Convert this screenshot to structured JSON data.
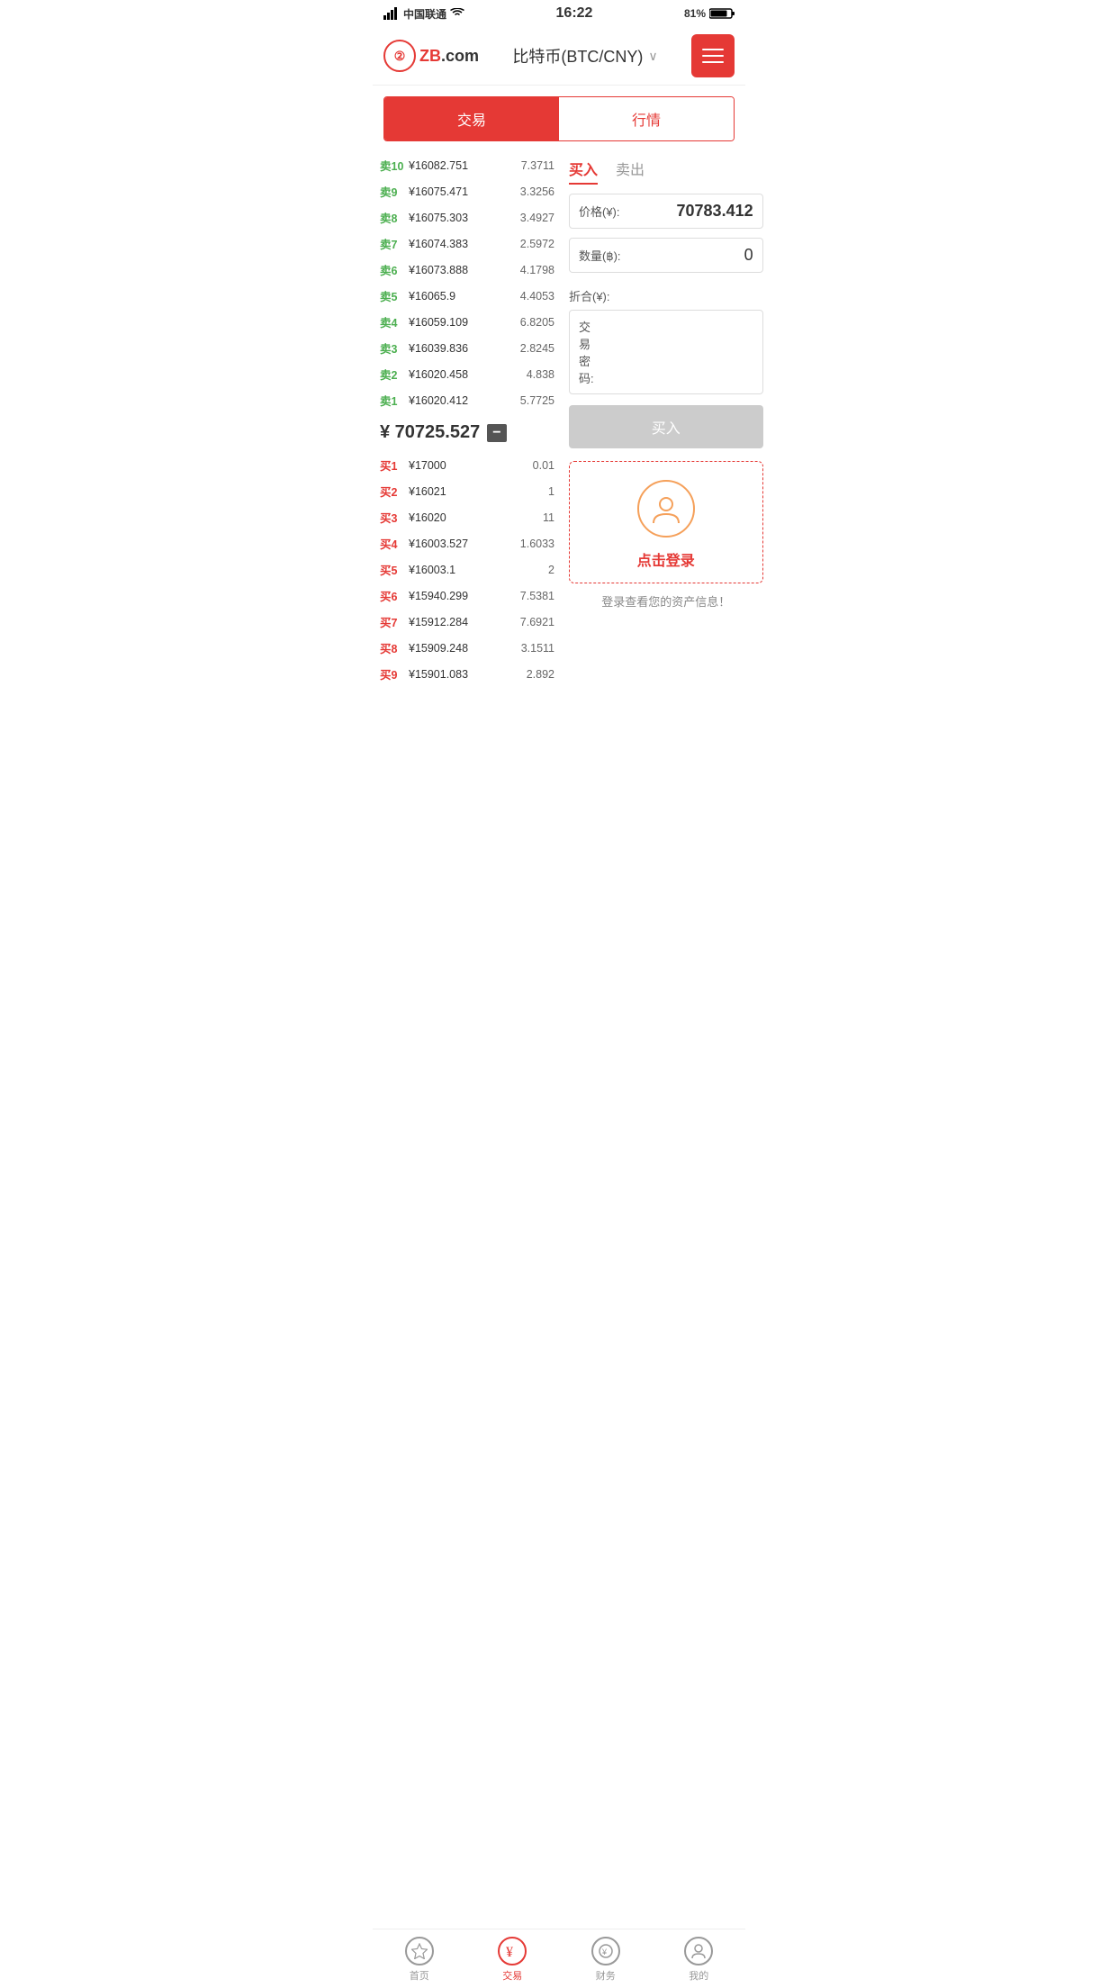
{
  "statusBar": {
    "carrier": "中国联通",
    "time": "16:22",
    "battery": "81%"
  },
  "header": {
    "logo": "ZB",
    "logoSuffix": ".com",
    "title": "比特币(BTC/CNY)",
    "chevron": "∨",
    "menuLabel": "menu"
  },
  "tabs": {
    "tab1": "交易",
    "tab2": "行情",
    "activeTab": "tab1"
  },
  "orderBook": {
    "sellOrders": [
      {
        "label": "卖10",
        "price": "¥16082.751",
        "amount": "7.3711"
      },
      {
        "label": "卖9",
        "price": "¥16075.471",
        "amount": "3.3256"
      },
      {
        "label": "卖8",
        "price": "¥16075.303",
        "amount": "3.4927"
      },
      {
        "label": "卖7",
        "price": "¥16074.383",
        "amount": "2.5972"
      },
      {
        "label": "卖6",
        "price": "¥16073.888",
        "amount": "4.1798"
      },
      {
        "label": "卖5",
        "price": "¥16065.9",
        "amount": "4.4053"
      },
      {
        "label": "卖4",
        "price": "¥16059.109",
        "amount": "6.8205"
      },
      {
        "label": "卖3",
        "price": "¥16039.836",
        "amount": "2.8245"
      },
      {
        "label": "卖2",
        "price": "¥16020.458",
        "amount": "4.838"
      },
      {
        "label": "卖1",
        "price": "¥16020.412",
        "amount": "5.7725"
      }
    ],
    "currentPrice": "¥70725.527",
    "priceDirection": "−",
    "buyOrders": [
      {
        "label": "买1",
        "price": "¥17000",
        "amount": "0.01"
      },
      {
        "label": "买2",
        "price": "¥16021",
        "amount": "1"
      },
      {
        "label": "买3",
        "price": "¥16020",
        "amount": "11"
      },
      {
        "label": "买4",
        "price": "¥16003.527",
        "amount": "1.6033"
      },
      {
        "label": "买5",
        "price": "¥16003.1",
        "amount": "2"
      },
      {
        "label": "买6",
        "price": "¥15940.299",
        "amount": "7.5381"
      },
      {
        "label": "买7",
        "price": "¥15912.284",
        "amount": "7.6921"
      },
      {
        "label": "买8",
        "price": "¥15909.248",
        "amount": "3.1511"
      },
      {
        "label": "买9",
        "price": "¥15901.083",
        "amount": "2.892"
      }
    ]
  },
  "tradePanel": {
    "buyTab": "买入",
    "sellTab": "卖出",
    "activeTab": "buy",
    "priceLabel": "价格(¥):",
    "priceValue": "70783.412",
    "quantityLabel": "数量(฿):",
    "quantityValue": "0",
    "totalLabel": "折合(¥):",
    "totalValue": "",
    "passwordLabel": "交易密码:",
    "passwordValue": "",
    "buyButtonLabel": "买入"
  },
  "loginPrompt": {
    "text": "点击登录",
    "tip": "登录查看您的资产信息！"
  },
  "bottomNav": [
    {
      "label": "首页",
      "icon": "★",
      "active": false
    },
    {
      "label": "交易",
      "icon": "¥",
      "active": true
    },
    {
      "label": "财务",
      "icon": "💰",
      "active": false
    },
    {
      "label": "我的",
      "icon": "👤",
      "active": false
    }
  ]
}
